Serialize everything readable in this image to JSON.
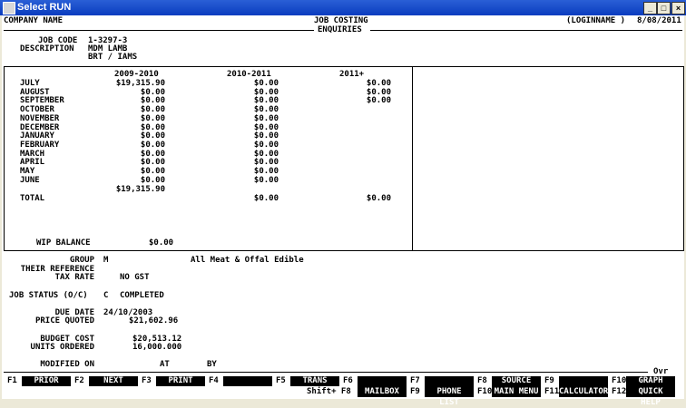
{
  "window": {
    "title": "Select RUN"
  },
  "header": {
    "company": "COMPANY NAME",
    "module": "JOB COSTING",
    "submodule": "ENQUIRIES",
    "user": "(LOGINNAME )",
    "date": "8/08/2011"
  },
  "job": {
    "code_label": "JOB CODE",
    "code": "1-3297-3",
    "desc_label": "DESCRIPTION",
    "desc1": "MDM LAMB",
    "desc2": "BRT / IAMS"
  },
  "periods": {
    "col1": "2009-2010",
    "col2": "2010-2011",
    "col3": "2011+"
  },
  "months": [
    {
      "m": "JULY",
      "a": "$19,315.90",
      "b": "$0.00",
      "c": "$0.00"
    },
    {
      "m": "AUGUST",
      "a": "$0.00",
      "b": "$0.00",
      "c": "$0.00"
    },
    {
      "m": "SEPTEMBER",
      "a": "$0.00",
      "b": "$0.00",
      "c": "$0.00"
    },
    {
      "m": "OCTOBER",
      "a": "$0.00",
      "b": "$0.00",
      "c": ""
    },
    {
      "m": "NOVEMBER",
      "a": "$0.00",
      "b": "$0.00",
      "c": ""
    },
    {
      "m": "DECEMBER",
      "a": "$0.00",
      "b": "$0.00",
      "c": ""
    },
    {
      "m": "JANUARY",
      "a": "$0.00",
      "b": "$0.00",
      "c": ""
    },
    {
      "m": "FEBRUARY",
      "a": "$0.00",
      "b": "$0.00",
      "c": ""
    },
    {
      "m": "MARCH",
      "a": "$0.00",
      "b": "$0.00",
      "c": ""
    },
    {
      "m": "APRIL",
      "a": "$0.00",
      "b": "$0.00",
      "c": ""
    },
    {
      "m": "MAY",
      "a": "$0.00",
      "b": "$0.00",
      "c": ""
    },
    {
      "m": "JUNE",
      "a": "$0.00",
      "b": "$0.00",
      "c": ""
    }
  ],
  "subtotal": {
    "a": "$19,315.90"
  },
  "total": {
    "label": "TOTAL",
    "b": "$0.00",
    "c": "$0.00"
  },
  "wip": {
    "label": "WIP BALANCE",
    "value": "$0.00"
  },
  "details": {
    "group_label": "GROUP",
    "group": "M",
    "group_desc": "All Meat & Offal Edible",
    "their_ref_label": "THEIR REFERENCE",
    "tax_label": "TAX RATE",
    "tax": "NO GST",
    "status_label": "JOB STATUS (O/C)",
    "status_code": "C",
    "status": "COMPLETED",
    "due_label": "DUE DATE",
    "due": "24/10/2003",
    "price_label": "PRICE QUOTED",
    "price": "$21,602.96",
    "budget_label": "BUDGET COST",
    "budget": "$20,513.12",
    "units_label": "UNITS ORDERED",
    "units": "16,000.000",
    "modified_label": "MODIFIED ON",
    "at_label": "AT",
    "by_label": "BY"
  },
  "ovr": "Ovr",
  "fkeys": [
    {
      "key": "F1",
      "label": "PRIOR"
    },
    {
      "key": "F2",
      "label": "NEXT"
    },
    {
      "key": "F3",
      "label": "PRINT"
    },
    {
      "key": "F4",
      "label": ""
    },
    {
      "key": "F5",
      "label": "TRANS"
    },
    {
      "key": "F6",
      "label": "",
      "key2": "Shift+ F8",
      "label2": "MAILBOX"
    },
    {
      "key": "F7",
      "label": "",
      "key2": "F9",
      "label2": "PHONE LIST"
    },
    {
      "key": "F8",
      "label": "SOURCE",
      "key2": "F10",
      "label2": "MAIN MENU"
    },
    {
      "key": "F9",
      "label": "",
      "key2": "F11",
      "label2": "CALCULATOR"
    },
    {
      "key": "F10",
      "label": "GRAPH",
      "key2": "F12",
      "label2": "QUICK HELP"
    }
  ]
}
